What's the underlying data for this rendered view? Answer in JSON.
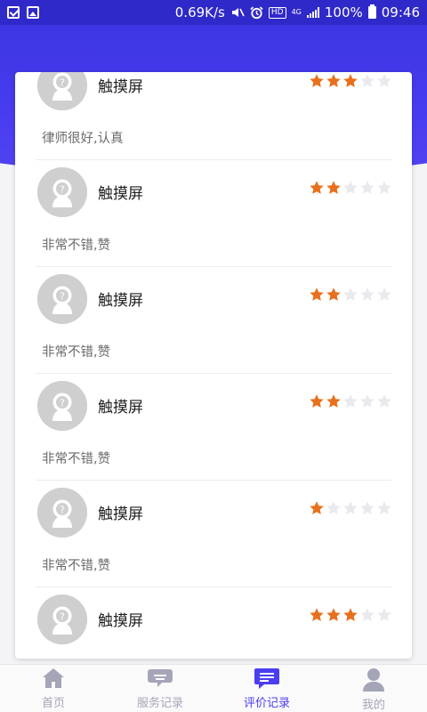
{
  "status_bar": {
    "net_speed": "0.69K/s",
    "network_type": "4G",
    "battery": "100%",
    "time": "09:46",
    "icons": [
      "checkbox-notification-icon",
      "image-notification-icon",
      "mute-icon",
      "alarm-icon",
      "hd-badge",
      "signal-icon",
      "battery-icon"
    ],
    "hd_label": "HD"
  },
  "reviews": [
    {
      "name": "触摸屏",
      "rating": 3,
      "max": 5,
      "comment": "律师很好,认真"
    },
    {
      "name": "触摸屏",
      "rating": 2,
      "max": 5,
      "comment": "非常不错,赞"
    },
    {
      "name": "触摸屏",
      "rating": 2,
      "max": 5,
      "comment": "非常不错,赞"
    },
    {
      "name": "触摸屏",
      "rating": 2,
      "max": 5,
      "comment": "非常不错,赞"
    },
    {
      "name": "触摸屏",
      "rating": 1,
      "max": 5,
      "comment": "非常不错,赞"
    },
    {
      "name": "触摸屏",
      "rating": 3,
      "max": 5,
      "comment": ""
    }
  ],
  "tabs": [
    {
      "label": "首页",
      "icon": "home-icon",
      "active": false
    },
    {
      "label": "服务记录",
      "icon": "chat-bubble-icon",
      "active": false
    },
    {
      "label": "评价记录",
      "icon": "comment-list-icon",
      "active": true
    },
    {
      "label": "我的",
      "icon": "person-icon",
      "active": false
    }
  ],
  "colors": {
    "brand": "#4a3ef0",
    "star_on": "#e8701c",
    "star_off": "#e9e9ee",
    "tab_inactive": "#a5a5b8"
  }
}
